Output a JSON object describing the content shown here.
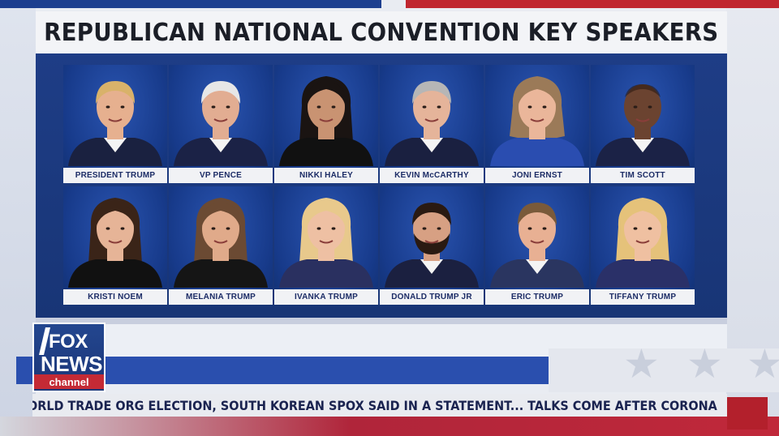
{
  "title": "REPUBLICAN NATIONAL CONVENTION KEY SPEAKERS",
  "speakers": [
    {
      "name": "PRESIDENT TRUMP"
    },
    {
      "name": "VP PENCE"
    },
    {
      "name": "NIKKI HALEY"
    },
    {
      "name": "KEVIN McCARTHY"
    },
    {
      "name": "JONI ERNST"
    },
    {
      "name": "TIM SCOTT"
    },
    {
      "name": "KRISTI NOEM"
    },
    {
      "name": "MELANIA TRUMP"
    },
    {
      "name": "IVANKA TRUMP"
    },
    {
      "name": "DONALD TRUMP JR"
    },
    {
      "name": "ERIC TRUMP"
    },
    {
      "name": "TIFFANY TRUMP"
    }
  ],
  "logo": {
    "line1": "FOX",
    "line2": "NEWS",
    "line3": "channel"
  },
  "ticker": "ORLD TRADE ORG ELECTION, SOUTH KOREAN SPOX SAID IN A STATEMENT...   TALKS COME AFTER CORONA",
  "colors": {
    "panel": "#1e3d86",
    "label_text": "#1c2c66",
    "red": "#c0283a",
    "brand_blue": "#23468f"
  },
  "portraits": [
    {
      "hair": "#d9b26a",
      "skin": "#e6b08f",
      "suit": "#1a2140",
      "style": "short"
    },
    {
      "hair": "#e7e7e7",
      "skin": "#e2ad92",
      "suit": "#1b2246",
      "style": "short"
    },
    {
      "hair": "#1a1412",
      "skin": "#c99372",
      "suit": "#111",
      "style": "long"
    },
    {
      "hair": "#b6b6b6",
      "skin": "#e5b49a",
      "suit": "#1a2040",
      "style": "short"
    },
    {
      "hair": "#9b7a58",
      "skin": "#eab69a",
      "suit": "#2a4db0",
      "style": "bob"
    },
    {
      "hair": "#2b1a12",
      "skin": "#6b4330",
      "suit": "#1b2246",
      "style": "bald"
    },
    {
      "hair": "#3a2418",
      "skin": "#e6b497",
      "suit": "#111",
      "style": "long"
    },
    {
      "hair": "#6b4a33",
      "skin": "#e0aa8a",
      "suit": "#151515",
      "style": "long"
    },
    {
      "hair": "#e8c98c",
      "skin": "#eec0a3",
      "suit": "#2a3060",
      "style": "long"
    },
    {
      "hair": "#2a1a12",
      "skin": "#d7a083",
      "suit": "#1b2040",
      "style": "beard"
    },
    {
      "hair": "#7a5a3a",
      "skin": "#e8b093",
      "suit": "#2a3560",
      "style": "short"
    },
    {
      "hair": "#e5c27a",
      "skin": "#efc0a1",
      "suit": "#2a3068",
      "style": "long"
    }
  ]
}
